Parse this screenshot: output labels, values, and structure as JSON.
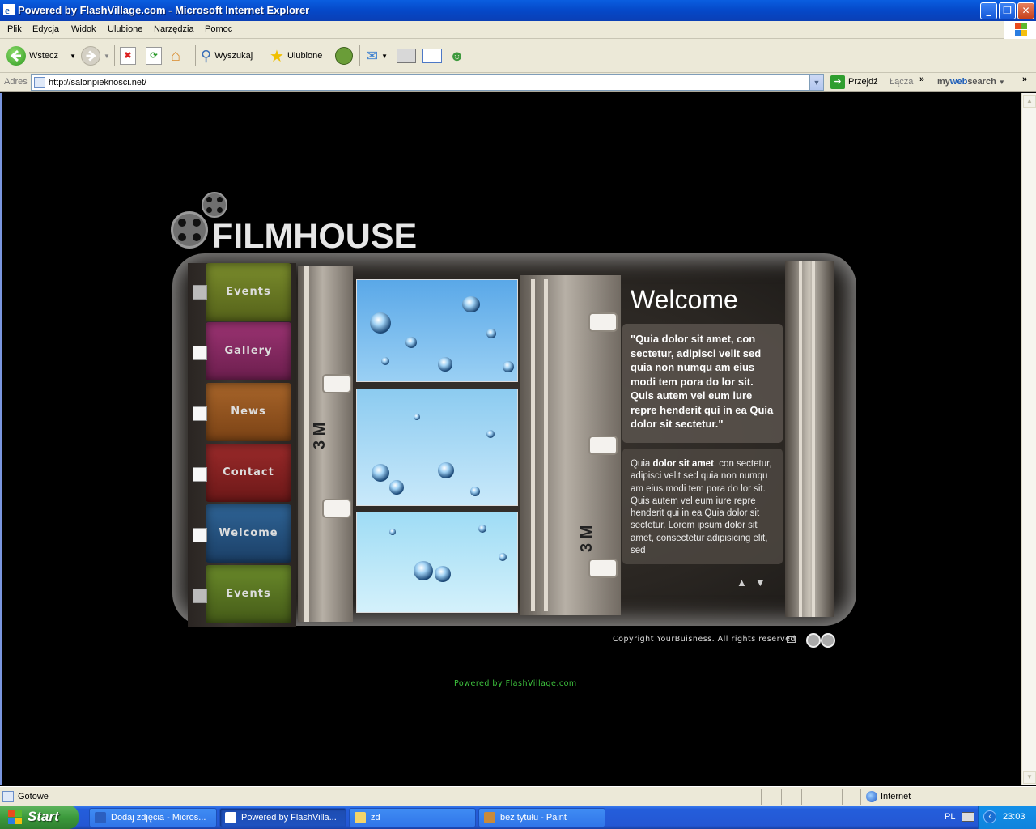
{
  "window": {
    "title": "Powered by FlashVillage.com - Microsoft Internet Explorer",
    "buttons": {
      "minimize": "_",
      "maximize": "❐",
      "close": "✕"
    }
  },
  "menu": [
    "Plik",
    "Edycja",
    "Widok",
    "Ulubione",
    "Narzędzia",
    "Pomoc"
  ],
  "toolbar": {
    "back": "Wstecz",
    "search": "Wyszukaj",
    "favorites": "Ulubione"
  },
  "address": {
    "label": "Adres",
    "url": "http://salonpieknosci.net/",
    "go": "Przejdź",
    "links": "Łącza",
    "mywebsearch_prefix": "my",
    "mywebsearch_bold": "web",
    "mywebsearch_suffix": "search"
  },
  "site": {
    "brand": "FILMHOUSE",
    "nav": [
      {
        "label": "Events",
        "color": "#5e6e1f"
      },
      {
        "label": "Gallery",
        "color": "#7b2657"
      },
      {
        "label": "News",
        "color": "#8a4f1a"
      },
      {
        "label": "Contact",
        "color": "#7a1f1f"
      },
      {
        "label": "Welcome",
        "color": "#1f4a72"
      },
      {
        "label": "Events",
        "color": "#4f6a1b"
      }
    ],
    "panel_title": "Welcome",
    "quote": "\"Quia dolor sit amet, con sectetur, adipisci velit sed quia non numqu am eius modi tem pora do lor sit. Quis autem vel eum iure repre henderit qui in ea Quia dolor sit sectetur.\"",
    "body_lead": "Quia ",
    "body_bold": "dolor sit amet",
    "body_rest": ", con sectetur, adipisci velit sed quia non numqu am eius modi tem pora do lor sit. Quis autem vel eum iure repre henderit qui in ea Quia dolor sit sectetur. Lorem ipsum dolor sit amet, consectetur adipisicing elit, sed",
    "scroll_arrows": "▲▼",
    "film_mark_left": "3 M",
    "film_mark_right": "3 M",
    "copyright": "Copyright YourBuisness. All rights reserved",
    "powered": "Powered by FlashVillage.com"
  },
  "status": {
    "text": "Gotowe",
    "zone": "Internet"
  },
  "taskbar": {
    "start": "Start",
    "tasks": [
      {
        "label": "Dodaj zdjęcia - Micros...",
        "active": false
      },
      {
        "label": "Powered by FlashVilla...",
        "active": true
      },
      {
        "label": "zd",
        "active": false
      },
      {
        "label": "bez tytułu - Paint",
        "active": false
      }
    ],
    "lang": "PL",
    "clock": "23:03"
  }
}
